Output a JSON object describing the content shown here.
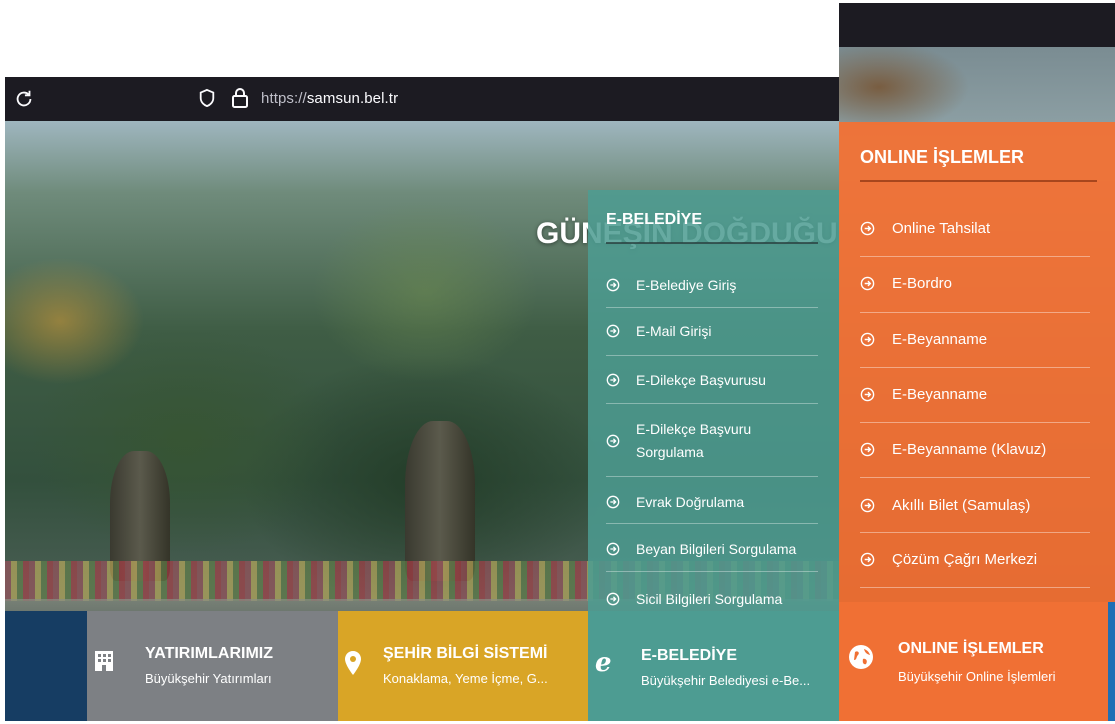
{
  "browser": {
    "url_protocol": "https://",
    "url_host": "samsun.bel.tr",
    "icons": [
      "reload-icon",
      "shield-icon",
      "lock-icon"
    ]
  },
  "hero": {
    "title": "GÜNEŞİN DOĞDUĞU"
  },
  "e_belediye_panel": {
    "title": "E-BELEDİYE",
    "items": [
      {
        "label": "E-Belediye Giriş"
      },
      {
        "label": "E-Mail Girişi"
      },
      {
        "label": "E-Dilekçe Başvurusu"
      },
      {
        "label": "E-Dilekçe Başvuru Sorgulama"
      },
      {
        "label": "Evrak Doğrulama"
      },
      {
        "label": "Beyan Bilgileri Sorgulama"
      },
      {
        "label": "Sicil Bilgileri Sorgulama"
      }
    ]
  },
  "online_panel": {
    "title": "ONLINE İŞLEMLER",
    "items": [
      {
        "label": "Online Tahsilat"
      },
      {
        "label": "E-Bordro"
      },
      {
        "label": "E-Beyanname"
      },
      {
        "label": "E-Beyanname"
      },
      {
        "label": "E-Beyanname (Klavuz)"
      },
      {
        "label": "Akıllı Bilet (Samulaş)"
      },
      {
        "label": "Çözüm Çağrı Merkezi"
      }
    ]
  },
  "tiles": [
    {
      "title": "YATIRIMLARIMIZ",
      "subtitle": "Büyükşehir Yatırımları",
      "icon": "building-icon",
      "color": "#7d8084"
    },
    {
      "title": "ŞEHİR BİLGİ SİSTEMİ",
      "subtitle": "Konaklama, Yeme İçme, G...",
      "icon": "map-pin-icon",
      "color": "#d9a526"
    },
    {
      "title": "E-BELEDİYE",
      "subtitle": "Büyükşehir Belediyesi e-Be...",
      "icon": "internet-explorer-icon",
      "color": "#4d9c92"
    },
    {
      "title": "ONLINE İŞLEMLER",
      "subtitle": "Büyükşehir Online İşlemleri",
      "icon": "globe-icon",
      "color": "#f07034"
    }
  ],
  "colors": {
    "browser_bar": "#1c1b22",
    "teal": "#4d9c92",
    "orange": "#f07034",
    "navy": "#163d63"
  }
}
